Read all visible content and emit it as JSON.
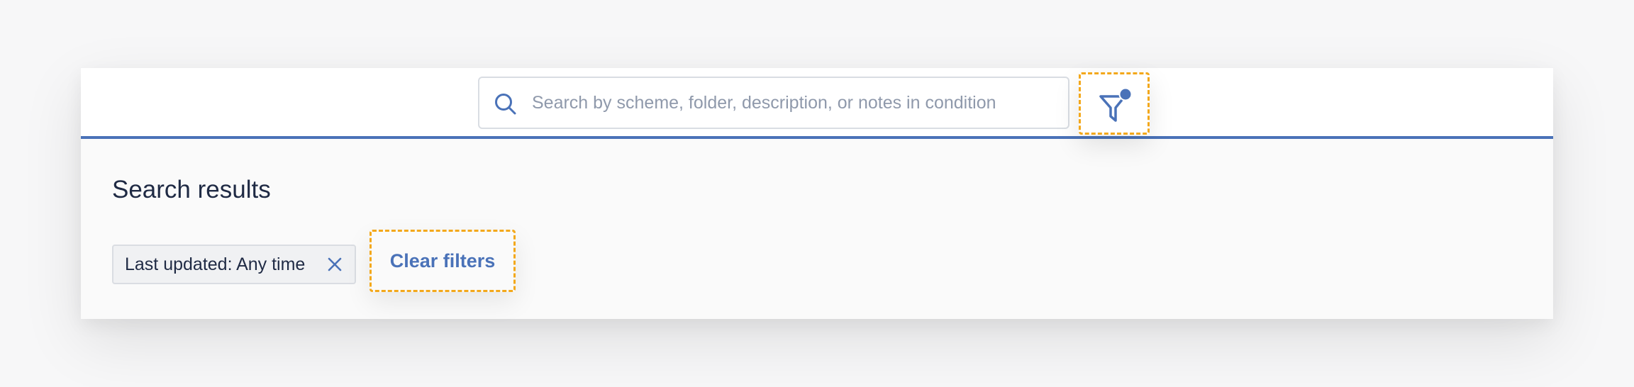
{
  "search": {
    "placeholder": "Search by scheme, folder, description, or notes in condition",
    "value": ""
  },
  "filter_button": {
    "icon": "filter-funnel-icon",
    "has_active_indicator": true
  },
  "results": {
    "title": "Search results"
  },
  "active_filters": [
    {
      "label": "Last updated: Any time",
      "remove_icon": "close-icon"
    }
  ],
  "clear_filters_label": "Clear filters",
  "colors": {
    "accent": "#4a72b8",
    "highlight_dash": "#f3a81b",
    "text_primary": "#1f2a44",
    "placeholder": "#8f99ab",
    "chip_background": "#f0f1f3"
  }
}
